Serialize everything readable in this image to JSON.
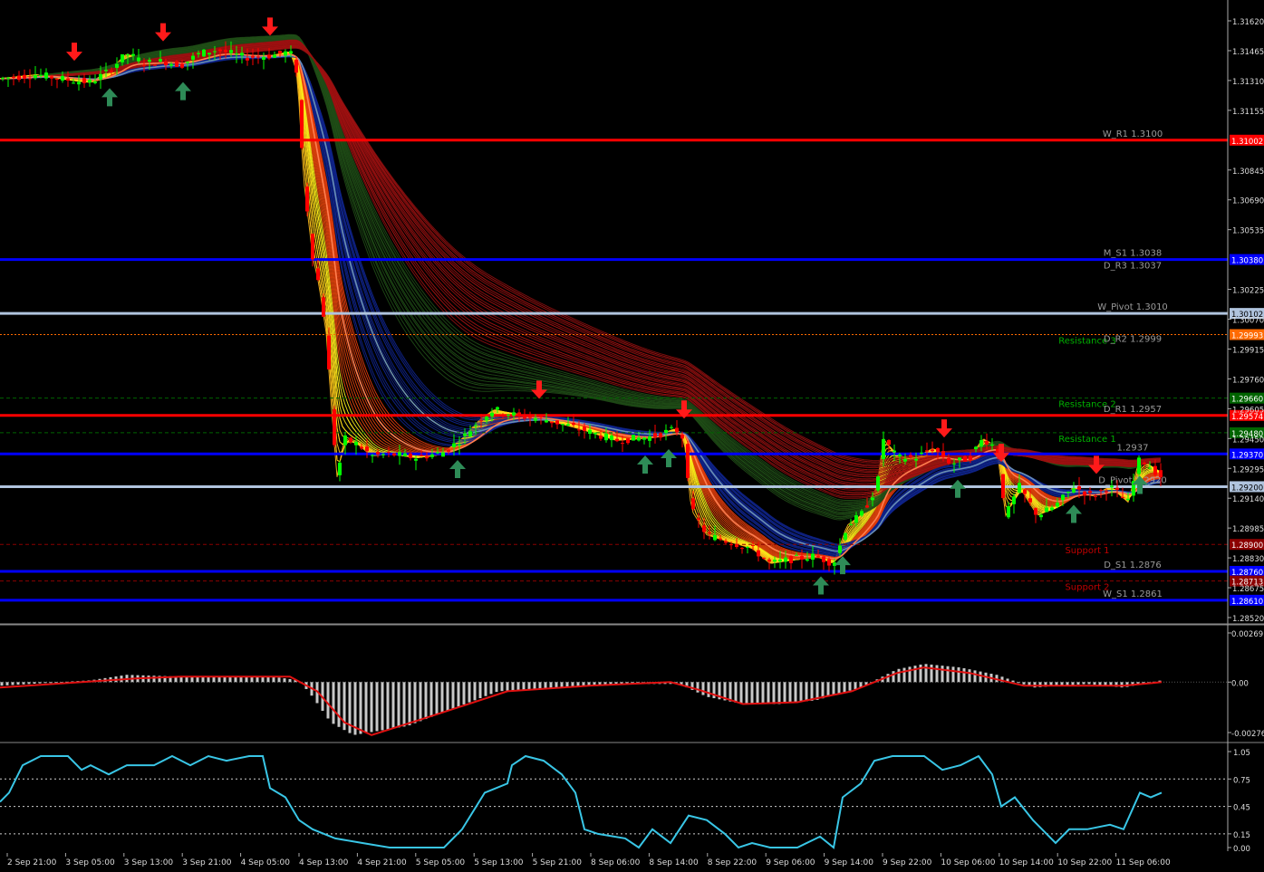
{
  "chart_data": [
    {
      "type": "candlestick",
      "panel": "main",
      "title": "",
      "ylim": [
        1.2852,
        1.317
      ],
      "y_ticks": [
        "1.31620",
        "1.31465",
        "1.31310",
        "1.31155",
        "1.30845",
        "1.30690",
        "1.30535",
        "1.30225",
        "1.30070",
        "1.29915",
        "1.29760",
        "1.29605",
        "1.29450",
        "1.29295",
        "1.29140",
        "1.28985",
        "1.28830",
        "1.28675",
        "1.28520"
      ],
      "price_path": [
        [
          0,
          1.3132
        ],
        [
          40,
          1.3134
        ],
        [
          80,
          1.3131
        ],
        [
          100,
          1.313
        ],
        [
          120,
          1.3136
        ],
        [
          140,
          1.3145
        ],
        [
          160,
          1.314
        ],
        [
          180,
          1.3141
        ],
        [
          200,
          1.3139
        ],
        [
          220,
          1.3145
        ],
        [
          240,
          1.3147
        ],
        [
          270,
          1.3143
        ],
        [
          300,
          1.3144
        ],
        [
          320,
          1.3146
        ],
        [
          328,
          1.3135
        ],
        [
          335,
          1.308
        ],
        [
          345,
          1.304
        ],
        [
          352,
          1.3025
        ],
        [
          360,
          1.3
        ],
        [
          366,
          1.296
        ],
        [
          372,
          1.2925
        ],
        [
          380,
          1.2945
        ],
        [
          395,
          1.2942
        ],
        [
          410,
          1.2936
        ],
        [
          430,
          1.2937
        ],
        [
          460,
          1.2935
        ],
        [
          490,
          1.2938
        ],
        [
          510,
          1.2945
        ],
        [
          530,
          1.2955
        ],
        [
          545,
          1.296
        ],
        [
          570,
          1.2957
        ],
        [
          600,
          1.2955
        ],
        [
          640,
          1.295
        ],
        [
          680,
          1.2944
        ],
        [
          720,
          1.2946
        ],
        [
          745,
          1.295
        ],
        [
          755,
          1.2945
        ],
        [
          763,
          1.2908
        ],
        [
          780,
          1.2895
        ],
        [
          800,
          1.2892
        ],
        [
          830,
          1.2888
        ],
        [
          850,
          1.288
        ],
        [
          870,
          1.2882
        ],
        [
          900,
          1.2884
        ],
        [
          920,
          1.288
        ],
        [
          935,
          1.29
        ],
        [
          950,
          1.2905
        ],
        [
          968,
          1.292
        ],
        [
          975,
          1.2945
        ],
        [
          990,
          1.2935
        ],
        [
          1010,
          1.2935
        ],
        [
          1030,
          1.294
        ],
        [
          1050,
          1.2932
        ],
        [
          1070,
          1.2935
        ],
        [
          1085,
          1.2945
        ],
        [
          1100,
          1.294
        ],
        [
          1110,
          1.2905
        ],
        [
          1125,
          1.292
        ],
        [
          1145,
          1.2905
        ],
        [
          1165,
          1.291
        ],
        [
          1185,
          1.292
        ],
        [
          1205,
          1.2915
        ],
        [
          1225,
          1.292
        ],
        [
          1245,
          1.2912
        ],
        [
          1258,
          1.2935
        ],
        [
          1270,
          1.293
        ],
        [
          1282,
          1.2925
        ]
      ],
      "horizontal_levels": [
        {
          "label": "W_R1 1.3100",
          "value": 1.31,
          "color": "#ff0000",
          "style": "solid",
          "tag": "1.31002"
        },
        {
          "label": "M_S1 1.3038",
          "value": 1.3038,
          "color": "#0000ff",
          "style": "solid",
          "tag": "1.30380"
        },
        {
          "label": "D_R3 1.3037",
          "value": 1.3037,
          "color": "#0000ff",
          "style": "none",
          "tag": ""
        },
        {
          "label": "W_Pivot 1.3010",
          "value": 1.301,
          "color": "#b0c4de",
          "style": "solid",
          "tag": "1.30102"
        },
        {
          "label": "Resistance 3",
          "value": 1.2999,
          "color": "#ff6a00",
          "style": "dotted",
          "tag": "1.29993"
        },
        {
          "label": "D_R2 1.2999",
          "value": 1.2999,
          "color": "#ff6a00",
          "style": "none",
          "tag": ""
        },
        {
          "label": "Resistance 2",
          "value": 1.2966,
          "color": "#006400",
          "style": "dashed",
          "tag": "1.29660"
        },
        {
          "label": "D_R1 1.2957",
          "value": 1.2957,
          "color": "#ff0000",
          "style": "solid",
          "tag": "1.29574"
        },
        {
          "label": "Resistance 1",
          "value": 1.2948,
          "color": "#006400",
          "style": "dashed",
          "tag": "1.29480"
        },
        {
          "label": "1.2937",
          "value": 1.2937,
          "color": "#0000ff",
          "style": "solid",
          "tag": "1.29370"
        },
        {
          "label": "D_Pivot 1.2920",
          "value": 1.292,
          "color": "#b0c4de",
          "style": "solid",
          "tag": "1.29200"
        },
        {
          "label": "Support 1",
          "value": 1.289,
          "color": "#8b0000",
          "style": "dashed",
          "tag": "1.28900"
        },
        {
          "label": "D_S1 1.2876",
          "value": 1.2876,
          "color": "#0000ff",
          "style": "solid",
          "tag": "1.28760"
        },
        {
          "label": "Support 2",
          "value": 1.2871,
          "color": "#8b0000",
          "style": "dashed",
          "tag": "1.28713"
        },
        {
          "label": "W_S1 1.2861",
          "value": 1.2861,
          "color": "#0000ff",
          "style": "solid",
          "tag": "1.28610"
        }
      ],
      "buy_arrows_x": [
        121,
        202,
        505,
        712,
        738,
        906,
        930,
        1057,
        1185,
        1258
      ],
      "sell_arrows_x": [
        82,
        180,
        298,
        595,
        755,
        1042,
        1105,
        1210
      ]
    },
    {
      "type": "bar",
      "panel": "oscillator",
      "ylim": [
        -0.00276,
        0.00269
      ],
      "y_ticks": [
        "0.00269",
        "0.00",
        "-0.00276"
      ],
      "series": [
        {
          "name": "",
          "points": [
            [
              0,
              -0.0002
            ],
            [
              100,
              0.0001
            ],
            [
              140,
              0.0004
            ],
            [
              200,
              0.0003
            ],
            [
              300,
              0.0003
            ],
            [
              330,
              0.0001
            ],
            [
              345,
              -0.0008
            ],
            [
              365,
              -0.0022
            ],
            [
              390,
              -0.0029
            ],
            [
              450,
              -0.0024
            ],
            [
              550,
              -0.0005
            ],
            [
              620,
              -0.0003
            ],
            [
              700,
              -0.0001
            ],
            [
              750,
              -0.0001
            ],
            [
              780,
              -0.0008
            ],
            [
              820,
              -0.0012
            ],
            [
              860,
              -0.0012
            ],
            [
              900,
              -0.001
            ],
            [
              950,
              -0.0003
            ],
            [
              990,
              0.0007
            ],
            [
              1020,
              0.001
            ],
            [
              1060,
              0.0008
            ],
            [
              1100,
              0.0004
            ],
            [
              1140,
              -0.0003
            ],
            [
              1200,
              -0.0001
            ],
            [
              1240,
              -0.0003
            ],
            [
              1282,
              0.0001
            ]
          ]
        },
        {
          "name": "",
          "points": [
            [
              0,
              -0.0003
            ],
            [
              150,
              0.0002
            ],
            [
              200,
              0.0003
            ],
            [
              320,
              0.0003
            ],
            [
              350,
              -0.0005
            ],
            [
              380,
              -0.0022
            ],
            [
              410,
              -0.0029
            ],
            [
              480,
              -0.0018
            ],
            [
              560,
              -0.0005
            ],
            [
              650,
              -0.0002
            ],
            [
              740,
              0.0
            ],
            [
              770,
              -0.0004
            ],
            [
              820,
              -0.0012
            ],
            [
              880,
              -0.0011
            ],
            [
              940,
              -0.0005
            ],
            [
              990,
              0.0005
            ],
            [
              1020,
              0.0008
            ],
            [
              1070,
              0.0005
            ],
            [
              1130,
              -0.0002
            ],
            [
              1180,
              -0.0002
            ],
            [
              1240,
              -0.0002
            ],
            [
              1282,
              0.0
            ]
          ]
        }
      ]
    },
    {
      "type": "line",
      "panel": "stochastic",
      "ylim": [
        0.0,
        1.05
      ],
      "y_ticks": [
        "1.05",
        "0.75",
        "0.45",
        "0.15",
        "0.00"
      ],
      "x_ticks": [
        "2 Sep 21:00",
        "3 Sep 05:00",
        "3 Sep 13:00",
        "3 Sep 21:00",
        "4 Sep 05:00",
        "4 Sep 13:00",
        "4 Sep 21:00",
        "5 Sep 05:00",
        "5 Sep 13:00",
        "5 Sep 21:00",
        "8 Sep 06:00",
        "8 Sep 14:00",
        "8 Sep 22:00",
        "9 Sep 06:00",
        "9 Sep 14:00",
        "9 Sep 22:00",
        "10 Sep 06:00",
        "10 Sep 14:00",
        "10 Sep 22:00",
        "11 Sep 06:00"
      ],
      "series": [
        {
          "name": "",
          "points": [
            [
              0,
              0.5
            ],
            [
              10,
              0.6
            ],
            [
              25,
              0.9
            ],
            [
              45,
              1.0
            ],
            [
              75,
              1.0
            ],
            [
              90,
              0.85
            ],
            [
              100,
              0.9
            ],
            [
              120,
              0.8
            ],
            [
              140,
              0.9
            ],
            [
              170,
              0.9
            ],
            [
              190,
              1.0
            ],
            [
              210,
              0.9
            ],
            [
              230,
              1.0
            ],
            [
              250,
              0.95
            ],
            [
              275,
              1.0
            ],
            [
              290,
              1.0
            ],
            [
              298,
              0.65
            ],
            [
              315,
              0.55
            ],
            [
              330,
              0.3
            ],
            [
              345,
              0.2
            ],
            [
              370,
              0.1
            ],
            [
              400,
              0.05
            ],
            [
              430,
              0.0
            ],
            [
              490,
              0.0
            ],
            [
              510,
              0.2
            ],
            [
              535,
              0.6
            ],
            [
              560,
              0.7
            ],
            [
              565,
              0.9
            ],
            [
              580,
              1.0
            ],
            [
              600,
              0.95
            ],
            [
              620,
              0.8
            ],
            [
              635,
              0.6
            ],
            [
              645,
              0.2
            ],
            [
              660,
              0.15
            ],
            [
              690,
              0.1
            ],
            [
              705,
              0.0
            ],
            [
              720,
              0.2
            ],
            [
              740,
              0.05
            ],
            [
              760,
              0.35
            ],
            [
              780,
              0.3
            ],
            [
              800,
              0.15
            ],
            [
              815,
              0.0
            ],
            [
              830,
              0.05
            ],
            [
              850,
              0.0
            ],
            [
              880,
              0.0
            ],
            [
              905,
              0.12
            ],
            [
              920,
              0.0
            ],
            [
              930,
              0.55
            ],
            [
              950,
              0.7
            ],
            [
              965,
              0.95
            ],
            [
              985,
              1.0
            ],
            [
              1020,
              1.0
            ],
            [
              1040,
              0.85
            ],
            [
              1060,
              0.9
            ],
            [
              1080,
              1.0
            ],
            [
              1095,
              0.8
            ],
            [
              1105,
              0.45
            ],
            [
              1120,
              0.55
            ],
            [
              1140,
              0.3
            ],
            [
              1165,
              0.05
            ],
            [
              1180,
              0.2
            ],
            [
              1200,
              0.2
            ],
            [
              1225,
              0.25
            ],
            [
              1240,
              0.2
            ],
            [
              1258,
              0.6
            ],
            [
              1270,
              0.55
            ],
            [
              1282,
              0.6
            ]
          ]
        }
      ]
    }
  ]
}
